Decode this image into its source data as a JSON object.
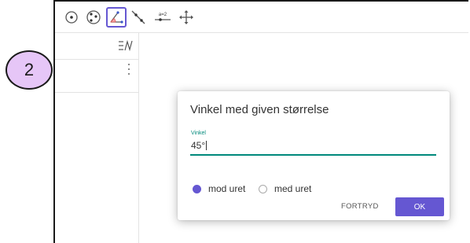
{
  "toolbar": {
    "tools": [
      {
        "name": "circle-center-point-tool",
        "icon": "circle-with-center-icon",
        "selected": false
      },
      {
        "name": "circle-through-points-tool",
        "icon": "circle-through-points-icon",
        "selected": false
      },
      {
        "name": "angle-given-size-tool",
        "icon": "angle-icon",
        "selected": true
      },
      {
        "name": "line-tool",
        "icon": "line-through-points-icon",
        "selected": false
      },
      {
        "name": "slider-tool",
        "icon": "slider-icon",
        "label": "a=2",
        "selected": false
      },
      {
        "name": "move-graphics-tool",
        "icon": "move-arrows-icon",
        "selected": false
      }
    ]
  },
  "algebra": {
    "menu_icon": "algebra-menu-icon",
    "row_options_icon": "kebab-icon"
  },
  "step_badge": {
    "label": "2"
  },
  "dialog": {
    "title": "Vinkel med given størrelse",
    "field_label": "Vinkel",
    "field_value": "45°",
    "options": [
      {
        "label": "mod uret",
        "selected": true
      },
      {
        "label": "med uret",
        "selected": false
      }
    ],
    "cancel_label": "FORTRYD",
    "ok_label": "OK"
  },
  "colors": {
    "accent": "#6557d2",
    "teal": "#00897b",
    "badge_fill": "#e6c6f7"
  }
}
